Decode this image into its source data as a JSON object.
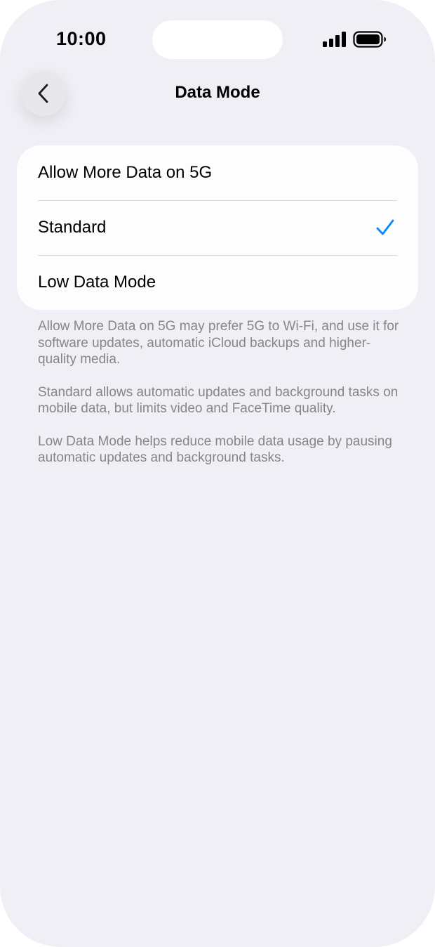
{
  "status_bar": {
    "time": "10:00",
    "signal_icon": "cellular-signal-icon",
    "battery_icon": "battery-full-icon"
  },
  "nav": {
    "title": "Data Mode",
    "back_icon": "chevron-left-icon"
  },
  "options": [
    {
      "label": "Allow More Data on 5G",
      "selected": false
    },
    {
      "label": "Standard",
      "selected": true
    },
    {
      "label": "Low Data Mode",
      "selected": false
    }
  ],
  "footnotes": [
    "Allow More Data on 5G may prefer 5G to Wi-Fi, and use it for software updates, automatic iCloud backups and higher-quality media.",
    "Standard allows automatic updates and background tasks on mobile data, but limits video and FaceTime quality.",
    "Low Data Mode helps reduce mobile data usage by pausing automatic updates and background tasks."
  ],
  "colors": {
    "background": "#f0eff5",
    "card": "#fdfdfe",
    "accent": "#0a84ff",
    "secondary_text": "#85858a"
  }
}
